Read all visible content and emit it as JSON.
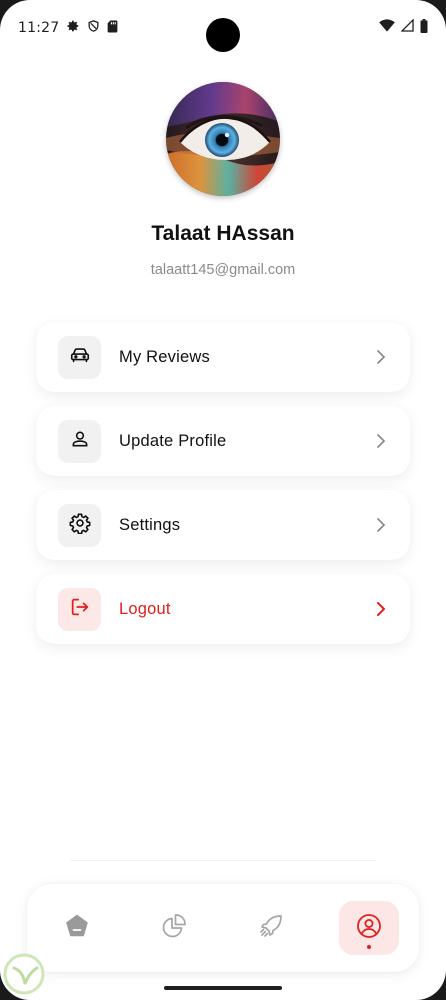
{
  "status_bar": {
    "time": "11:27",
    "icons_left": [
      "settings-icon",
      "shield-icon",
      "sd-card-icon"
    ],
    "icons_right": [
      "wifi-icon",
      "signal-icon",
      "battery-icon"
    ]
  },
  "profile": {
    "name": "Talaat HAssan",
    "email": "talaatt145@gmail.com"
  },
  "menu": [
    {
      "label": "My Reviews",
      "icon": "car-icon",
      "variant": "default"
    },
    {
      "label": "Update Profile",
      "icon": "user-icon",
      "variant": "default"
    },
    {
      "label": "Settings",
      "icon": "gear-icon",
      "variant": "default"
    },
    {
      "label": "Logout",
      "icon": "logout-icon",
      "variant": "danger"
    }
  ],
  "bottom_nav": {
    "items": [
      {
        "icon": "home-icon",
        "active": false
      },
      {
        "icon": "pie-chart-icon",
        "active": false
      },
      {
        "icon": "rocket-icon",
        "active": false
      },
      {
        "icon": "profile-icon",
        "active": true
      }
    ]
  },
  "colors": {
    "accent": "#e0201c",
    "accent_bg": "#fde6e6",
    "icon_box": "#f1f1f1",
    "text": "#111111",
    "muted": "#8a8a8a"
  }
}
